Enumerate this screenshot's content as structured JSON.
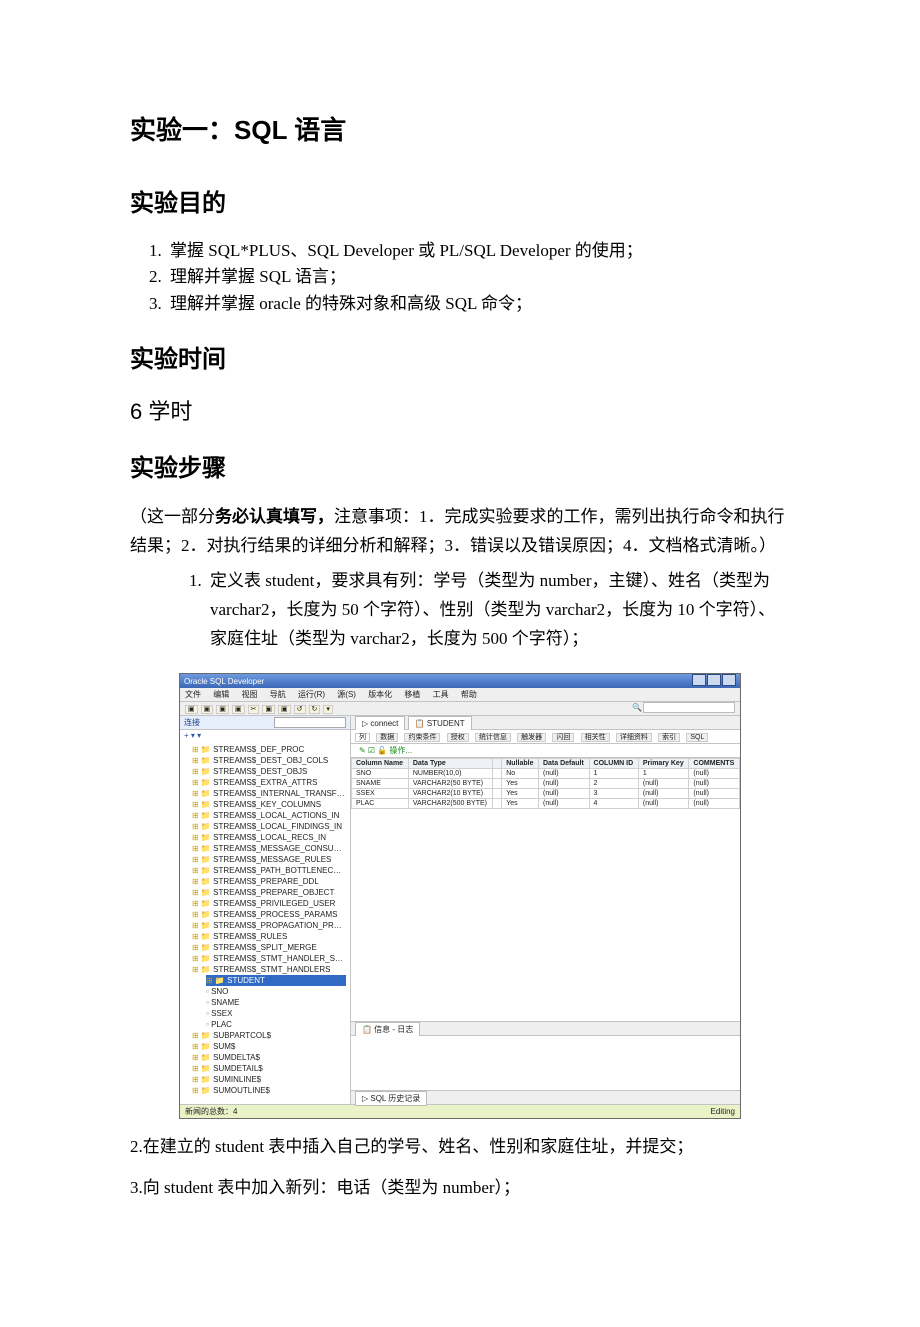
{
  "title": "实验一：SQL 语言",
  "sections": {
    "goal_heading": "实验目的",
    "time_heading": "实验时间",
    "time_value": "6 学时",
    "steps_heading": "实验步骤"
  },
  "goals": {
    "g1": "掌握 SQL*PLUS、SQL Developer 或 PL/SQL Developer 的使用；",
    "g2": "理解并掌握 SQL 语言；",
    "g3": "理解并掌握 oracle 的特殊对象和高级 SQL 命令；"
  },
  "steps_intro": {
    "open": "（这一部分",
    "emph": "务必认真填写，",
    "rest": "注意事项：1．完成实验要求的工作，需列出执行命令和执行结果；2．对执行结果的详细分析和解释；3．错误以及错误原因；4．文档格式清晰。）"
  },
  "step1": "定义表 student，要求具有列：学号（类型为 number，主键）、姓名（类型为 varchar2，长度为 50 个字符）、性别（类型为 varchar2，长度为 10 个字符）、家庭住址（类型为 varchar2，长度为 500 个字符）；",
  "step2": "2.在建立的 student 表中插入自己的学号、姓名、性别和家庭住址，并提交；",
  "step3": "3.向 student 表中加入新列：电话（类型为 number）；",
  "screenshot": {
    "window_title": "Oracle SQL Developer",
    "menu": {
      "m1": "文件",
      "m2": "编辑",
      "m3": "视图",
      "m4": "导航",
      "m5": "运行(R)",
      "m6": "源(S)",
      "m7": "版本化",
      "m8": "移植",
      "m9": "工具",
      "m10": "帮助"
    },
    "connections_label": "连接",
    "leftctl": "+ ▾ ▾",
    "tree": {
      "n0": "STREAMS$_DEF_PROC",
      "n1": "STREAMS$_DEST_OBJ_COLS",
      "n2": "STREAMS$_DEST_OBJS",
      "n3": "STREAMS$_EXTRA_ATTRS",
      "n4": "STREAMS$_INTERNAL_TRANSFORM",
      "n5": "STREAMS$_KEY_COLUMNS",
      "n6": "STREAMS$_LOCAL_ACTIONS_IN",
      "n7": "STREAMS$_LOCAL_FINDINGS_IN",
      "n8": "STREAMS$_LOCAL_RECS_IN",
      "n9": "STREAMS$_MESSAGE_CONSUMERS",
      "n10": "STREAMS$_MESSAGE_RULES",
      "n11": "STREAMS$_PATH_BOTTLENECK_IN",
      "n12": "STREAMS$_PREPARE_DDL",
      "n13": "STREAMS$_PREPARE_OBJECT",
      "n14": "STREAMS$_PRIVILEGED_USER",
      "n15": "STREAMS$_PROCESS_PARAMS",
      "n16": "STREAMS$_PROPAGATION_PROCS",
      "n17": "STREAMS$_RULES",
      "n18": "STREAMS$_SPLIT_MERGE",
      "n19": "STREAMS$_STMT_HANDLER_STMTS",
      "n20": "STREAMS$_STMT_HANDLERS",
      "sel": "STUDENT",
      "leaf1": "SNO",
      "leaf2": "SNAME",
      "leaf3": "SSEX",
      "leaf4": "PLAC",
      "n21": "SUBPARTCOL$",
      "n22": "SUM$",
      "n23": "SUMDELTA$",
      "n24": "SUMDETAIL$",
      "n25": "SUMINLINE$",
      "n26": "SUMOUTLINE$"
    },
    "main_tab_a": "▷ connect",
    "main_tab_b": "📋 STUDENT",
    "subtabs": {
      "t1": "列",
      "t2": "数据",
      "t3": "约束条件",
      "t4": "授权",
      "t5": "统计信息",
      "t6": "触发器",
      "t7": "闪回",
      "t8": "相关性",
      "t9": "详细资料",
      "t10": "索引",
      "t11": "SQL"
    },
    "local_actions": "✎ ☑ 🔓 操作...",
    "grid_headers": {
      "c1": "Column Name",
      "c2": "Data Type",
      "c3": "",
      "c4": "Nullable",
      "c5": "Data Default",
      "c6": "COLUMN ID",
      "c7": "Primary Key",
      "c8": "COMMENTS"
    },
    "grid_rows": [
      {
        "c1": "SNO",
        "c2": "NUMBER(10,0)",
        "c3": "",
        "c4": "No",
        "c5": "(null)",
        "c6": "1",
        "c7": "1",
        "c8": "(null)"
      },
      {
        "c1": "SNAME",
        "c2": "VARCHAR2(50 BYTE)",
        "c3": "",
        "c4": "Yes",
        "c5": "(null)",
        "c6": "2",
        "c7": "(null)",
        "c8": "(null)"
      },
      {
        "c1": "SSEX",
        "c2": "VARCHAR2(10 BYTE)",
        "c3": "",
        "c4": "Yes",
        "c5": "(null)",
        "c6": "3",
        "c7": "(null)",
        "c8": "(null)"
      },
      {
        "c1": "PLAC",
        "c2": "VARCHAR2(500 BYTE)",
        "c3": "",
        "c4": "Yes",
        "c5": "(null)",
        "c6": "4",
        "c7": "(null)",
        "c8": "(null)"
      }
    ],
    "msg_tab": "📋 信息 - 日志",
    "low_tab1": "▷ SQL 历史记录",
    "status_left": "新闻的总数：4",
    "status_right": "Editing"
  }
}
